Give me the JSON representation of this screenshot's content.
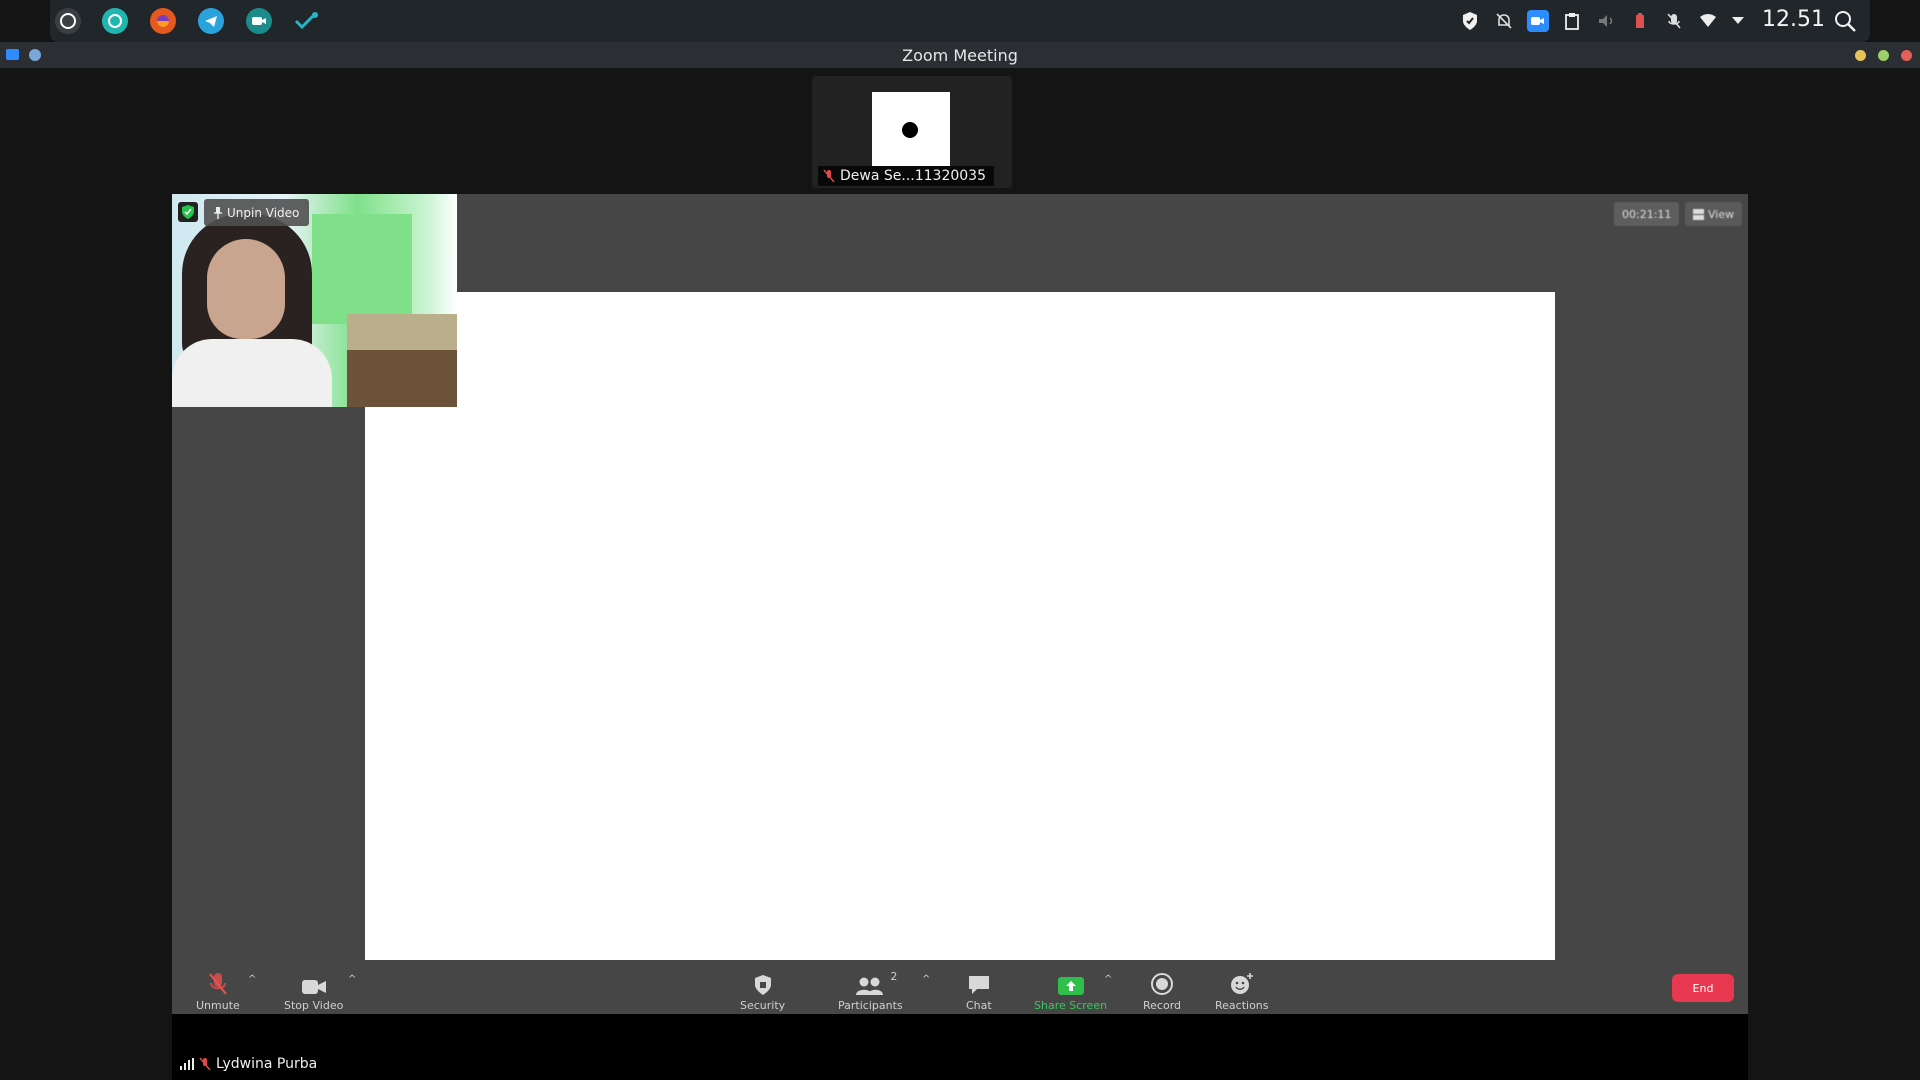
{
  "system_bar": {
    "dock": [
      "obs-icon",
      "browser-circle-icon",
      "firefox-icon",
      "telegram-icon",
      "zoom-icon",
      "vscode-icon"
    ],
    "tray": [
      "shield-icon",
      "notifications-off-icon",
      "zoom-tray-icon",
      "clipboard-icon",
      "volume-icon",
      "battery-icon",
      "mic-muted-icon",
      "wifi-icon",
      "dropdown-icon"
    ],
    "clock": "12.51"
  },
  "window": {
    "title": "Zoom Meeting"
  },
  "thumbnail": {
    "name": "Dewa Se...11320035",
    "muted": true
  },
  "main": {
    "unpin_label": "Unpin Video",
    "timer": "00:21:11",
    "view_label": "View"
  },
  "toolbar": {
    "unmute": "Unmute",
    "stop_video": "Stop Video",
    "security": "Security",
    "participants": "Participants",
    "participant_count": "2",
    "chat": "Chat",
    "share_screen": "Share Screen",
    "record": "Record",
    "reactions": "Reactions",
    "end": "End"
  },
  "self": {
    "name": "Lydwina Purba"
  },
  "colors": {
    "accent": "#2d8cff",
    "share_green": "#2fbf4a",
    "end_red": "#e8384f"
  }
}
